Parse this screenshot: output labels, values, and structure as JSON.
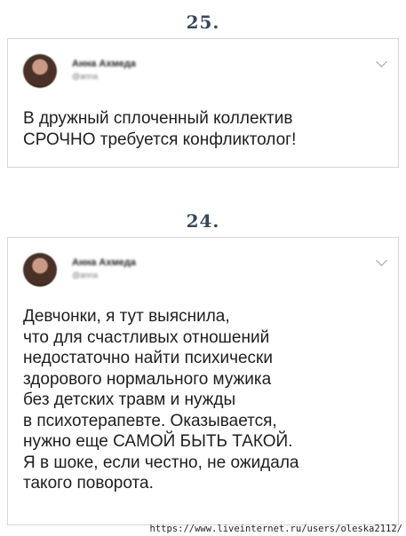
{
  "posts": [
    {
      "number": "25.",
      "author_name": "Анна Ахмеда",
      "author_handle": "@anna",
      "text": "В дружный сплоченный коллектив\nСРОЧНО требуется конфликтолог!"
    },
    {
      "number": "24.",
      "author_name": "Анна Ахмеда",
      "author_handle": "@anna",
      "text": "Девчонки, я тут выяснила,\nчто для счастливых отношений\nнедостаточно найти психически\nздорового нормального мужика\nбез детских травм и нужды\nв психотерапевте. Оказывается,\nнужно еще САМОЙ БЫТЬ ТАКОЙ.\nЯ в шоке, если честно, не ожидала\nтакого поворота."
    }
  ],
  "watermark": "https://www.liveinternet.ru/users/oleska2112/"
}
